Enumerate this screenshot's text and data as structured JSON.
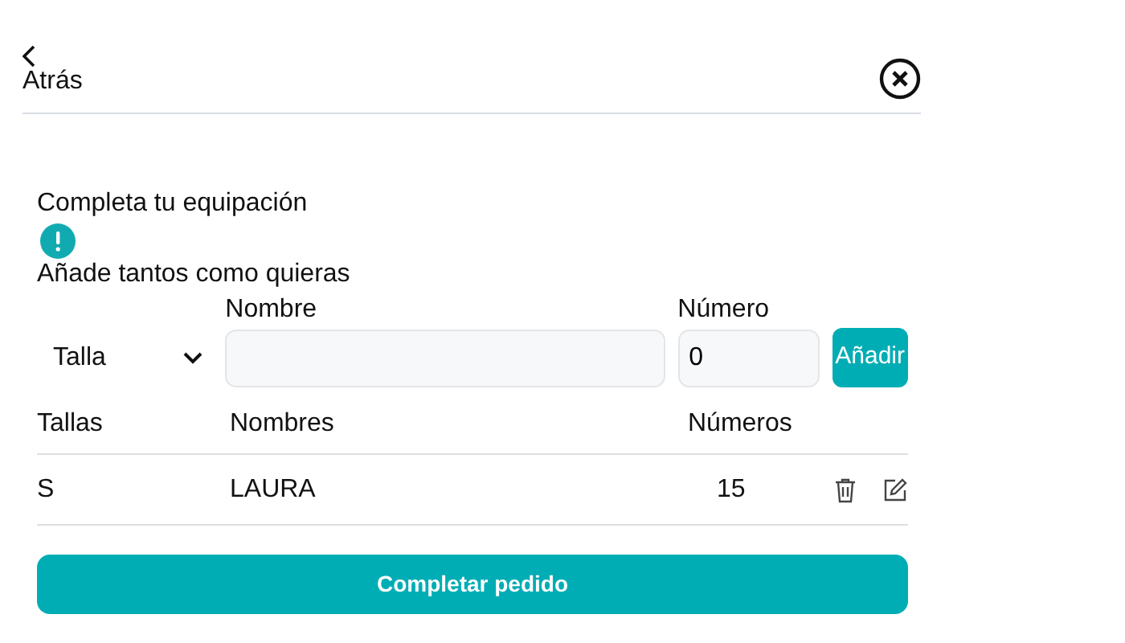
{
  "header": {
    "back_label": "Atrás"
  },
  "title": "Completa tu equipación",
  "subtitle": "Añade tantos como quieras",
  "form": {
    "size_select": "Talla",
    "name_label": "Nombre",
    "number_label": "Número",
    "number_value": "0",
    "add_button": "Añadir"
  },
  "table": {
    "columns": [
      "Tallas",
      "Nombres",
      "Números"
    ],
    "rows": [
      {
        "size": "S",
        "name": "LAURA",
        "number": "15"
      }
    ]
  },
  "submit_button": "Completar pedido"
}
